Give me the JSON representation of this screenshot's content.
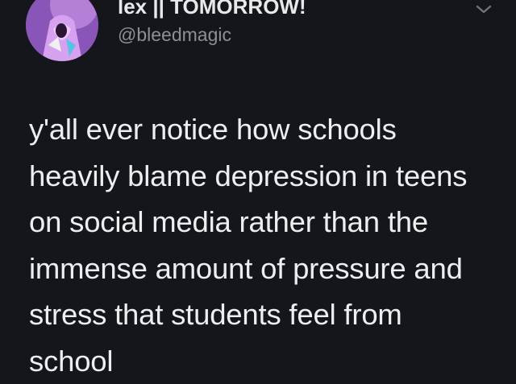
{
  "tweet": {
    "author": {
      "display_name": "lex || TOMORROW!",
      "handle": "@bleedmagic"
    },
    "text_lines": [
      "y'all ever notice how schools",
      "heavily blame depression in teens",
      "on social media rather than the",
      "immense amount of pressure and",
      "stress that students feel from",
      "school"
    ]
  },
  "icons": {
    "avatar": "avatar-image",
    "menu": "chevron-down-icon"
  },
  "colors": {
    "background": "#15161b",
    "text": "#e7e9ea",
    "muted": "#8b9096"
  }
}
